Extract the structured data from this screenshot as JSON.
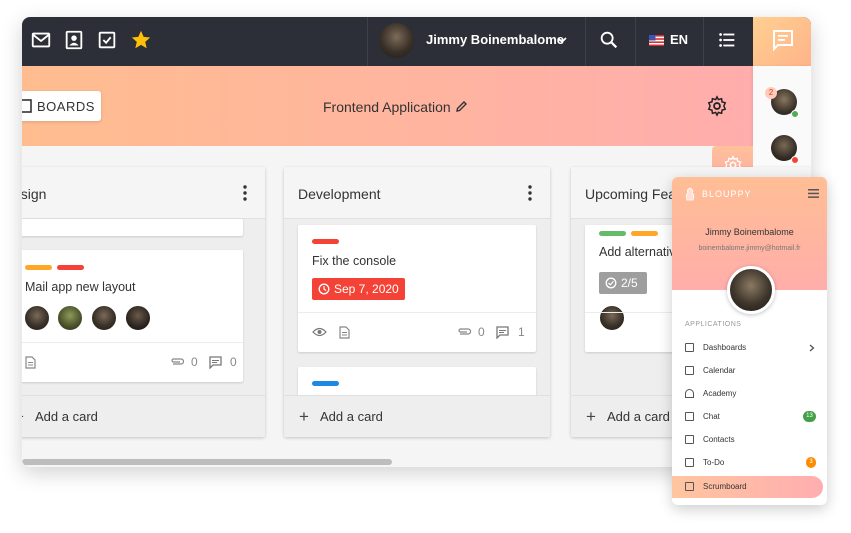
{
  "topbar": {
    "user_name": "Jimmy Boinembalome",
    "language": "EN",
    "icons": [
      "mail-icon",
      "contact-icon",
      "check-square-icon",
      "star-icon",
      "search-icon",
      "list-icon",
      "chat-icon"
    ]
  },
  "header": {
    "boards_label": "BOARDS",
    "board_title": "Frontend Application"
  },
  "rightbar": {
    "notification_count": "2"
  },
  "lists": [
    {
      "title": "esign",
      "add_card": "Add a card",
      "cards": [
        {
          "title": "Mail app new layout",
          "attachments": "0",
          "comments": "0"
        }
      ]
    },
    {
      "title": "Development",
      "add_card": "Add a card",
      "cards": [
        {
          "title": "Fix the console",
          "due_date": "Sep 7, 2020",
          "attachments": "0",
          "comments": "1"
        }
      ]
    },
    {
      "title": "Upcoming Feat",
      "add_card": "Add a card",
      "cards": [
        {
          "title": "Add alternativ",
          "checklist": "2/5"
        }
      ]
    }
  ],
  "sidebar": {
    "brand": "BLOUPPY",
    "user_name": "Jimmy Boinembalome",
    "email": "boinembalome.jimmy@hotmail.fr",
    "section": "APPLICATIONS",
    "items": [
      {
        "label": "Dashboards"
      },
      {
        "label": "Calendar"
      },
      {
        "label": "Academy"
      },
      {
        "label": "Chat",
        "badge": "13"
      },
      {
        "label": "Contacts"
      },
      {
        "label": "To-Do",
        "badge": "3"
      },
      {
        "label": "Scrumboard"
      }
    ]
  },
  "colors": {
    "topbar": "#2c2f38",
    "accent_gradient_start": "#ffbd8f",
    "accent_gradient_end": "#ffadad",
    "due_date_red": "#f44336",
    "label_red": "#f44336",
    "label_orange": "#ffa726",
    "label_green": "#66bb6a",
    "label_blue": "#1e88e5",
    "badge_green": "#43a047",
    "badge_orange": "#fb8c00"
  }
}
